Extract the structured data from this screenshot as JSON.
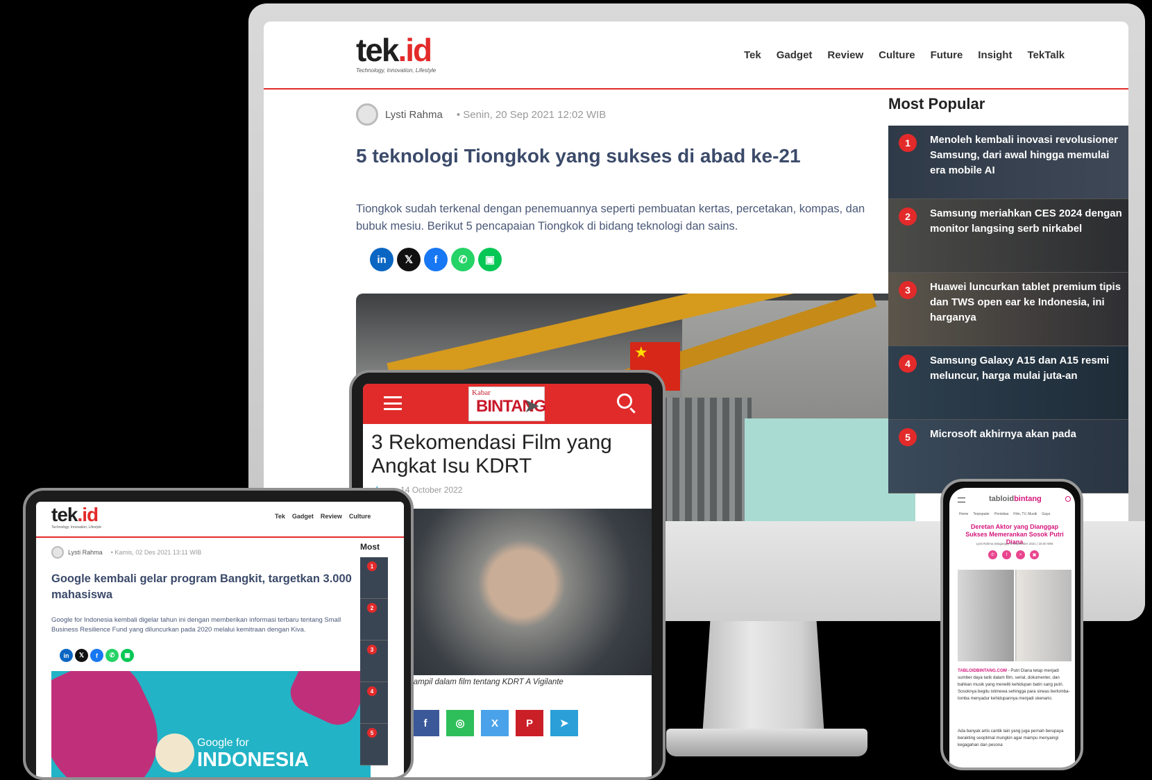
{
  "desktop": {
    "logo": "tek.id",
    "logo_sub": "Technology, Innovation, Lifestyle",
    "nav": [
      "Tek",
      "Gadget",
      "Review",
      "Culture",
      "Future",
      "Insight",
      "TekTalk"
    ],
    "author": "Lysti Rahma",
    "date": "Senin, 20 Sep 2021 12:02 WIB",
    "title": "5 teknologi Tiongkok yang sukses di abad ke-21",
    "lead": "Tiongkok sudah terkenal dengan penemuannya seperti pembuatan kertas, percetakan, kompas, dan bubuk mesiu. Berikut  5 pencapaian Tiongkok di bidang teknologi dan sains.",
    "share_icons": [
      "linkedin-icon",
      "x-icon",
      "facebook-icon",
      "whatsapp-icon",
      "line-icon"
    ],
    "sidebar_title": "Most Popular",
    "popular": [
      {
        "num": "1",
        "text": "Menoleh kembali inovasi revolusioner Samsung, dari awal hingga memulai era mobile AI"
      },
      {
        "num": "2",
        "text": "Samsung meriahkan CES 2024 dengan monitor langsing serb nirkabel"
      },
      {
        "num": "3",
        "text": "Huawei luncurkan tablet premium tipis dan TWS open ear ke Indonesia, ini harganya"
      },
      {
        "num": "4",
        "text": "Samsung Galaxy A15 dan A15 resmi meluncur, harga mulai juta-an"
      },
      {
        "num": "5",
        "text": "Microsoft akhirnya akan pada"
      }
    ],
    "accent": "#e32a2a"
  },
  "tablet_left": {
    "logo": "tek.id",
    "logo_sub": "Technology, Innovation, Lifestyle",
    "nav": [
      "Tek",
      "Gadget",
      "Review",
      "Culture"
    ],
    "author": "Lysti Rahma",
    "date": "Kamis, 02 Des 2021 13:11 WIB",
    "title": "Google kembali gelar program Bangkit, targetkan 3.000 mahasiswa",
    "lead": "Google for Indonesia kembali digelar tahun ini dengan memberikan informasi terbaru tentang Small Business Resilience Fund yang diluncurkan pada 2020 melalui kemitraan dengan Kiva.",
    "hero_small": "Google for",
    "hero_big": "INDONESIA",
    "sidebar_title": "Most",
    "popular_nums": [
      "1",
      "2",
      "3",
      "4",
      "5"
    ]
  },
  "tablet_center": {
    "logo_small": "Kabar",
    "logo_big": "BINTANG",
    "title": "3 Rekomendasi Film yang Angkat Isu KDRT",
    "author": "ahma",
    "date": "- 14 October 2022",
    "caption": "e tampil dalam film tentang KDRT A Vigilante",
    "share": [
      "f",
      "◎",
      "X",
      "P",
      "➤"
    ],
    "header_color": "#e12b2b"
  },
  "phone": {
    "logo_a": "tabloid",
    "logo_b": "bintang",
    "nav": [
      "Home",
      "Terpopuler",
      "Peristiwa",
      "Film, TV, Musik",
      "Gaya"
    ],
    "title": "Deretan Aktor yang Dianggap Sukses Memerankan Sosok Putri Diana",
    "meta": "Lysti Rahma (Magang) | 8 September 2021 | 16:00 WIB",
    "brand": "TABLOIDBINTANG.COM",
    "body1": " - Putri Diana tetap menjadi sumber daya tarik dalam film, serial, dokumenter, dan bahkan musik yang meneliti kehidupan batin sang putri. Sosoknya begitu istimewa sehingga para sineas berlomba-lomba menyadur kehidupannya menjadi skenario.",
    "body2": "Ada banyak artis cantik lain yang juga pernah berupaya berakting seoptimal mungkin agar mampu menyaingi kegagahan dan pesona",
    "accent": "#d4177b"
  }
}
